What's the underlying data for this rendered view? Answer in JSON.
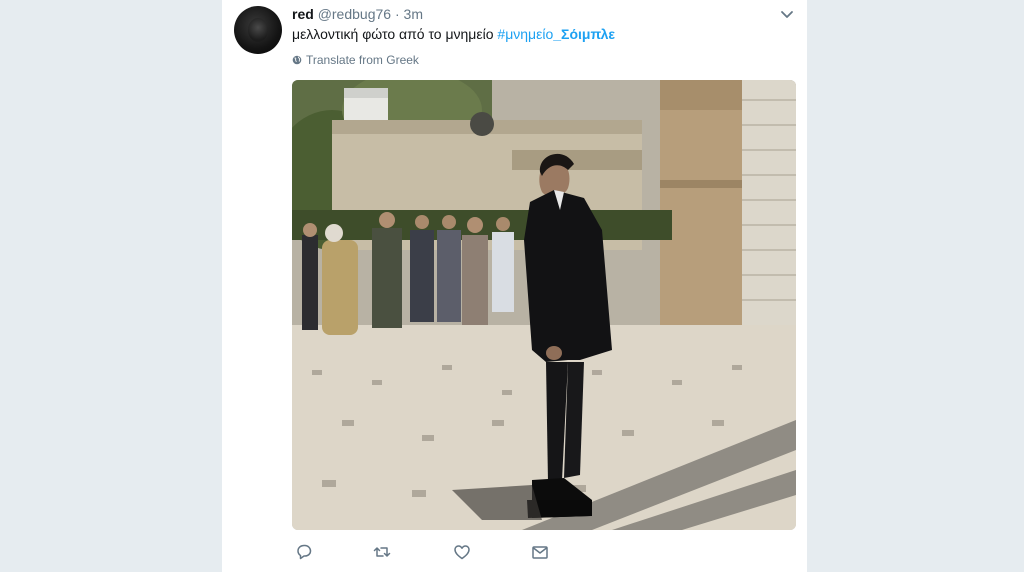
{
  "tweet": {
    "author_name": "red",
    "author_handle": "@redbug76",
    "separator": "·",
    "timestamp": "3m",
    "text": "μελλοντική φώτο από το μνημείο",
    "hashtags": [
      "#μνημείο",
      "_Σόιμπλε"
    ],
    "translate_label": "Translate from Greek"
  },
  "icons": {
    "caret": "chevron-down-icon",
    "globe": "globe-icon",
    "reply": "reply-icon",
    "retweet": "retweet-icon",
    "like": "heart-icon",
    "message": "envelope-icon"
  },
  "colors": {
    "link": "#1da1f2",
    "secondary_text": "#657786",
    "primary_text": "#14171a",
    "background": "#e6ecf0"
  }
}
